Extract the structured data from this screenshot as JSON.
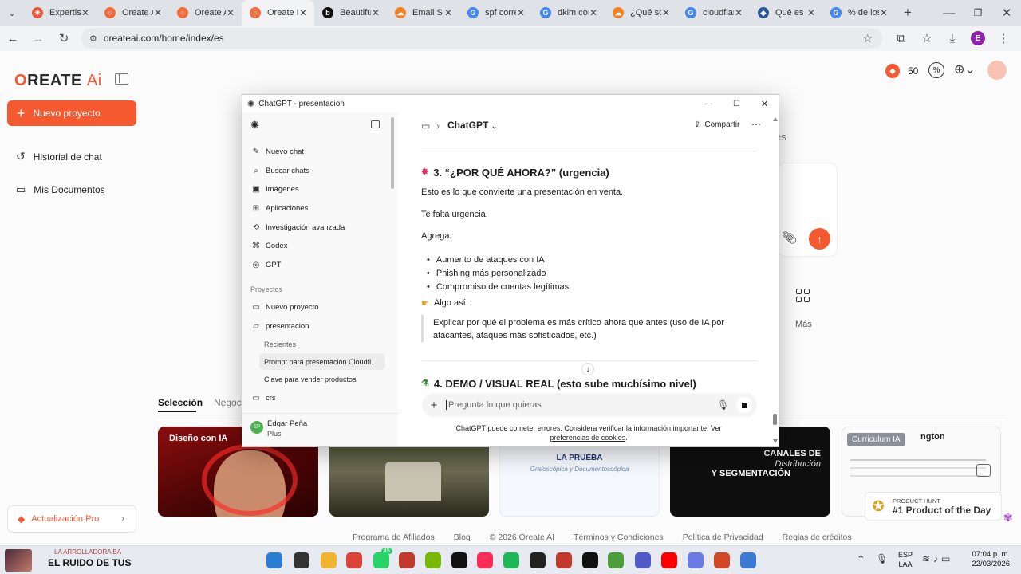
{
  "browser": {
    "tabs": [
      {
        "title": "Expertise",
        "color": "#e4573d",
        "glyph": "✳"
      },
      {
        "title": "Oreate AI",
        "color": "#f26b3a",
        "glyph": "○"
      },
      {
        "title": "Oreate AI",
        "color": "#f26b3a",
        "glyph": "○"
      },
      {
        "title": "Oreate IA",
        "color": "#f26b3a",
        "glyph": "○",
        "active": true
      },
      {
        "title": "Beautiful",
        "color": "#111111",
        "glyph": "b"
      },
      {
        "title": "Email Se",
        "color": "#f48120",
        "glyph": "☁"
      },
      {
        "title": "spf corre",
        "color": "#4285f4",
        "glyph": "G"
      },
      {
        "title": "dkim cor",
        "color": "#4285f4",
        "glyph": "G"
      },
      {
        "title": "¿Qué sor",
        "color": "#f48120",
        "glyph": "☁"
      },
      {
        "title": "cloudflar",
        "color": "#4285f4",
        "glyph": "G"
      },
      {
        "title": "Qué es e",
        "color": "#2b579a",
        "glyph": "◆"
      },
      {
        "title": "% de los",
        "color": "#4285f4",
        "glyph": "G"
      }
    ],
    "url": "oreateai.com/home/index/es",
    "profile_initial": "E"
  },
  "oreate": {
    "logo_o": "O",
    "logo_rest": "REATE",
    "logo_ai": "Ai",
    "new_project": "Nuevo proyecto",
    "nav": [
      "Historial de chat",
      "Mis Documentos"
    ],
    "credits": "50",
    "upgrade": "Actualización Pro",
    "tabs": [
      "Selección",
      "Negoci"
    ],
    "more_label": "Más",
    "footer_links": [
      "Programa de Afiliados",
      "Blog",
      "© 2026 Oreate AI",
      "Términos y Condiciones",
      "Política de Privacidad",
      "Reglas de créditos"
    ],
    "cards": [
      {
        "label": "Diseño con IA"
      },
      {
        "label": ""
      },
      {
        "label": "",
        "heading": "LA PRUEBA",
        "sub": "Grafoscópica y Documentoscópica"
      },
      {
        "label": "",
        "heading": "CANALES DE",
        "sub": "Distribución",
        "heading2": "Y SEGMENTACIÓN"
      },
      {
        "label": "Curriculum IA",
        "name_fragment": "ngton"
      }
    ],
    "product_hunt": {
      "small": "PRODUCT HUNT",
      "big": "#1 Product of the Day"
    },
    "peek_text": "es"
  },
  "chatgpt": {
    "window_title": "ChatGPT - presentacion",
    "sidebar": {
      "items": [
        "Nuevo chat",
        "Buscar chats",
        "Imágenes",
        "Aplicaciones",
        "Investigación avanzada",
        "Codex",
        "GPT"
      ],
      "section_projects": "Proyectos",
      "projects": [
        "Nuevo proyecto",
        "presentacion"
      ],
      "recents_label": "Recientes",
      "recents": [
        "Prompt para presentación Cloudfl...",
        "Clave para vender productos"
      ],
      "crs": "crs",
      "user_name": "Edgar Peña",
      "user_plan": "Plus",
      "user_initials": "EP"
    },
    "header": {
      "model": "ChatGPT",
      "share": "Compartir"
    },
    "message": {
      "h3": "3. “¿POR QUÉ AHORA?” (urgencia)",
      "p1": "Esto es lo que convierte una presentación en venta.",
      "p2": "Te falta urgencia.",
      "p3": "Agrega:",
      "bullets": [
        "Aumento de ataques con IA",
        "Phishing más personalizado",
        "Compromiso de cuentas legítimas"
      ],
      "example_label": "Algo así:",
      "quote": "Explicar por qué el problema es más crítico ahora que antes (uso de IA por atacantes, ataques más sofisticados, etc.)",
      "h4": "4. DEMO / VISUAL REAL (esto sube muchísimo nivel)"
    },
    "composer_placeholder": "Pregunta lo que quieras",
    "disclaimer": "ChatGPT puede cometer errores. Considera verificar la información importante. Ver",
    "disclaimer_link": "preferencias de cookies",
    "disclaimer_end": "."
  },
  "taskbar": {
    "media_small": "LA ARROLLADORA BA",
    "media_big": "EL RUIDO DE TUS",
    "lang1": "ESP",
    "lang2": "LAA",
    "time": "07:04 p. m.",
    "date": "22/03/2026",
    "whatsapp_badge": "45"
  }
}
